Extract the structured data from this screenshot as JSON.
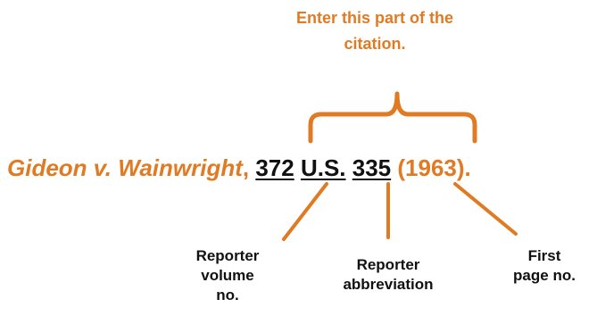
{
  "caption": {
    "text": "Enter this part of the\ncitation."
  },
  "citation": {
    "case_name": "Gideon v. Wainwright",
    "sep1": ", ",
    "volume": "372",
    "abbreviation": "U.S.",
    "page": "335",
    "year": "(1963)."
  },
  "labels": {
    "volume": "Reporter\nvolume\nno.",
    "abbreviation": "Reporter\nabbreviation",
    "page": "First\npage no."
  },
  "colors": {
    "accent": "#e07b24",
    "text": "#111111"
  }
}
